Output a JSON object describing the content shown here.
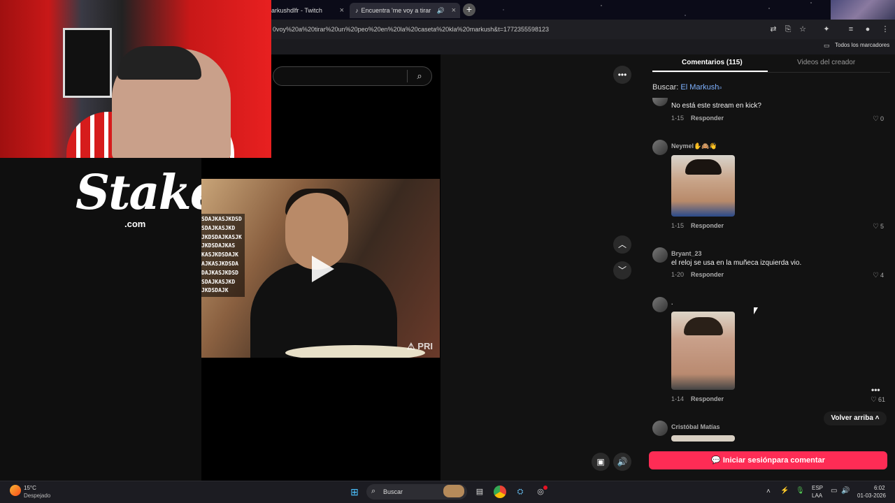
{
  "browser": {
    "tabs": [
      {
        "label": "arkushdlfr - Twitch",
        "active": false
      },
      {
        "label": "Encuentra 'me voy a tirar",
        "active": true
      }
    ],
    "url": "0voy%20a%20tirar%20un%20peo%20en%20la%20caseta%20kla%20markush&t=1772355598123",
    "bookmarks_label": "Todos los marcadores"
  },
  "overlay": {
    "stake_word": "Stake",
    "stake_domain": ".com"
  },
  "video": {
    "watermark_lines": [
      "SDAJKASJKDSD",
      "SDAJKASJKD",
      "JKDSDAJKASJK",
      "JKDSDAJKAS",
      "KASJKDSDAJK",
      "AJKASJKDSDA",
      "DAJKASJKDSD",
      "SDAJKASJKD",
      "JKDSDAJK"
    ],
    "brand_mark": "PRI"
  },
  "panel": {
    "tab_comments": "Comentarios (115)",
    "tab_creator": "Videos del creador",
    "search_prefix": "Buscar:",
    "search_term": "El Markush",
    "comments": [
      {
        "user": "",
        "text": "No está este stream en kick?",
        "date": "1-15",
        "reply": "Responder",
        "likes": "0"
      },
      {
        "user": "Neymel✋🙈👋",
        "text": "",
        "date": "1-15",
        "reply": "Responder",
        "likes": "5"
      },
      {
        "user": "Bryant_23",
        "text": "el reloj se usa en la muñeca izquierda vio.",
        "date": "1-20",
        "reply": "Responder",
        "likes": "4"
      },
      {
        "user": ".",
        "text": "",
        "date": "1-14",
        "reply": "Responder",
        "likes": "61"
      },
      {
        "user": "Cristóbal Matías",
        "text": "",
        "date": "",
        "reply": "",
        "likes": ""
      }
    ],
    "back_to_top": "Volver arriba",
    "login_button": "Iniciar sesiónpara comentar"
  },
  "taskbar": {
    "weather_temp": "15°C",
    "weather_desc": "Despejado",
    "search_label": "Buscar",
    "lang_top": "ESP",
    "lang_bottom": "LAA",
    "time": "6:02",
    "date": "01-03-2026"
  },
  "colors": {
    "accent_login": "#fe2c55",
    "search_link": "#7fb2ff"
  }
}
